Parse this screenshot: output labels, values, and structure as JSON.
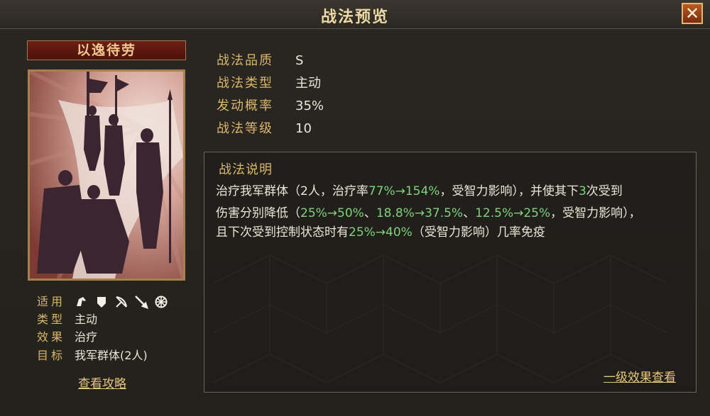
{
  "window": {
    "title": "战法预览",
    "close_label": "✕"
  },
  "skill": {
    "name": "以逸待劳"
  },
  "left_info": {
    "suitable_label": "适用",
    "unit_icons": [
      "cavalry-icon",
      "shield-icon",
      "archer-icon",
      "spear-icon",
      "siege-icon"
    ],
    "type_label": "类型",
    "type_value": "主动",
    "effect_label": "效果",
    "effect_value": "治疗",
    "target_label": "目标",
    "target_value": "我军群体(2人)",
    "guide_link": "查看攻略"
  },
  "stats": {
    "quality_label": "战法品质",
    "quality_value": "S",
    "kind_label": "战法类型",
    "kind_value": "主动",
    "rate_label": "发动概率",
    "rate_value": "35%",
    "level_label": "战法等级",
    "level_value": "10"
  },
  "description": {
    "title": "战法说明",
    "line1": [
      {
        "t": "治疗我军群体（2人，治疗率",
        "hl": false
      },
      {
        "t": "77%→154%",
        "hl": true
      },
      {
        "t": "，受智力影响），并使其下",
        "hl": false
      },
      {
        "t": "3",
        "hl": true
      },
      {
        "t": "次受到",
        "hl": false
      }
    ],
    "line2": [
      {
        "t": "伤害分别降低（",
        "hl": false
      },
      {
        "t": "25%→50%",
        "hl": true
      },
      {
        "t": "、",
        "hl": false
      },
      {
        "t": "18.8%→37.5%",
        "hl": true
      },
      {
        "t": "、",
        "hl": false
      },
      {
        "t": "12.5%→25%",
        "hl": true
      },
      {
        "t": "，受智力影响），",
        "hl": false
      }
    ],
    "line3": [
      {
        "t": "且下次受到控制状态时有",
        "hl": false
      },
      {
        "t": "25%→40%",
        "hl": true
      },
      {
        "t": "（受智力影响）几率免疫",
        "hl": false
      }
    ],
    "level_link": "一级效果查看"
  },
  "colors": {
    "gold": "#d8b76a",
    "text": "#ece6d8",
    "highlight": "#7fd27a",
    "banner": "#6e1f14"
  }
}
